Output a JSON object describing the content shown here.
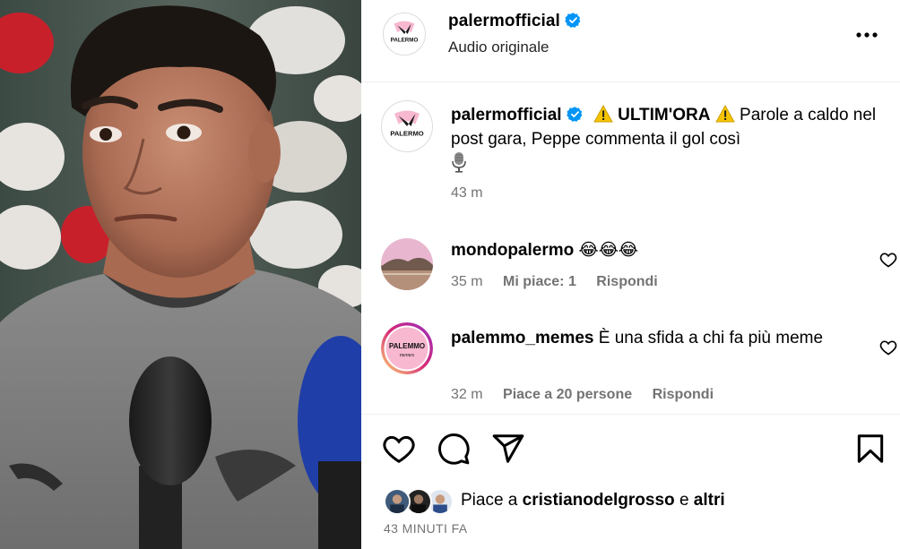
{
  "post": {
    "username": "palermofficial",
    "audio": "Audio originale",
    "verified": true
  },
  "caption": {
    "username": "palermofficial",
    "headline": "ULTIM'ORA",
    "text": "Parole a caldo nel post gara, Peppe commenta il gol così",
    "time": "43 m"
  },
  "comments": [
    {
      "username": "mondopalermo",
      "text": "😂😂😂",
      "time": "35 m",
      "likes_label": "Mi piace: 1",
      "reply_label": "Rispondi"
    },
    {
      "username": "palemmo_memes",
      "text": "È una sfida a chi fa più meme",
      "time": "32 m",
      "likes_label": "Piace a 20 persone",
      "reply_label": "Rispondi",
      "avatar_text": "PALEMMO",
      "avatar_sub": "memes"
    }
  ],
  "likes": {
    "prefix": "Piace a",
    "user": "cristianodelgrosso",
    "conj": "e",
    "others": "altri"
  },
  "timestamp": "43 MINUTI FA",
  "logo": {
    "wordmark": "PALERMO"
  },
  "colors": {
    "verified": "#0095f6",
    "meta_text": "#737373",
    "brand_pink": "#f7b8d0"
  },
  "icons": [
    "verified-badge-icon",
    "more-options-icon",
    "warning-icon",
    "microphone-icon",
    "heart-icon",
    "comment-icon",
    "share-icon",
    "bookmark-icon"
  ]
}
